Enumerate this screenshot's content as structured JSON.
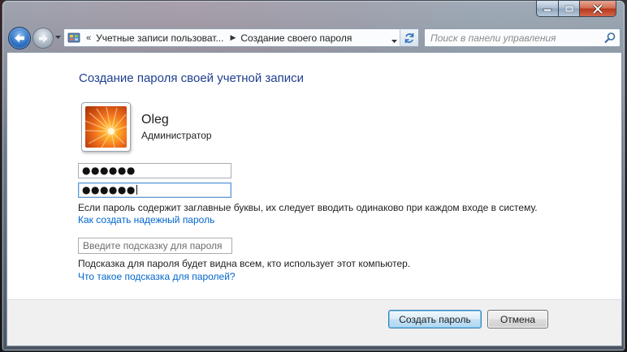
{
  "window": {
    "caption_buttons": [
      "minimize",
      "maximize",
      "close"
    ]
  },
  "nav": {
    "back_icon": "back-arrow-icon",
    "forward_icon": "forward-arrow-icon",
    "address": {
      "overflow_marker": "«",
      "crumbs": [
        "Учетные записи пользоват...",
        "Создание своего пароля"
      ],
      "crumb_separator": "▶"
    },
    "search": {
      "placeholder": "Поиск в панели управления"
    }
  },
  "page": {
    "title": "Создание пароля своей учетной записи",
    "user": {
      "name": "Oleg",
      "role": "Администратор"
    },
    "password": {
      "new_value": "●●●●●●",
      "confirm_value": "●●●●●●"
    },
    "case_note": "Если пароль содержит заглавные буквы, их следует вводить одинаково при каждом входе в систему.",
    "strong_password_link": "Как создать надежный пароль",
    "hint": {
      "placeholder": "Введите подсказку для пароля",
      "value": ""
    },
    "hint_note": "Подсказка для пароля будет видна всем, кто использует этот компьютер.",
    "hint_help_link": "Что такое подсказка для паролей?"
  },
  "footer": {
    "create_button": "Создать пароль",
    "cancel_button": "Отмена"
  },
  "colors": {
    "link": "#0066cc",
    "title": "#1e3f8f",
    "close_button": "#c0442a",
    "primary_button_border": "#3c7fb1"
  }
}
